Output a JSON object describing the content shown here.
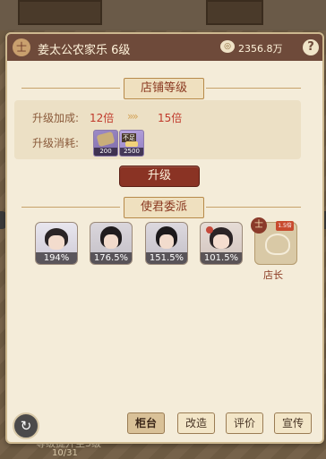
{
  "header": {
    "shop_name": "姜太公农家乐 6级",
    "coins": "2356.8万",
    "help": "?",
    "emblem": "士"
  },
  "upgrade_section": {
    "title": "店铺等级",
    "bonus_label": "升级加成:",
    "bonus_from": "12倍",
    "bonus_to": "15倍",
    "arrows": "»»",
    "cost_label": "升级消耗:",
    "cost_items": [
      {
        "name": "grain-bundle",
        "count": "200",
        "color": "#a8957a"
      },
      {
        "name": "shortage-item",
        "count": "2500",
        "color": "#b5a3d9",
        "tag": "不足"
      }
    ]
  },
  "upgrade_button": "升级",
  "envoy_section": {
    "title": "使君委派",
    "characters": [
      {
        "name": "envoy-1",
        "bonus": "194%"
      },
      {
        "name": "envoy-2",
        "bonus": "176.5%"
      },
      {
        "name": "envoy-3",
        "bonus": "151.5%"
      },
      {
        "name": "envoy-4",
        "bonus": "101.5%"
      }
    ],
    "manager": {
      "label": "店长",
      "badge": "1.5倍",
      "emblem": "士"
    }
  },
  "tabs": [
    {
      "label": "柜台",
      "active": true
    },
    {
      "label": "改造",
      "active": false
    },
    {
      "label": "评价",
      "active": false
    },
    {
      "label": "宣传",
      "active": false
    }
  ],
  "background_text": [
    "等级提升至3级",
    "10/31"
  ],
  "colors": {
    "header": "#6e4a3a",
    "accent_red": "#c0392b",
    "button": "#8a3324",
    "panel": "#f4ecd9"
  }
}
